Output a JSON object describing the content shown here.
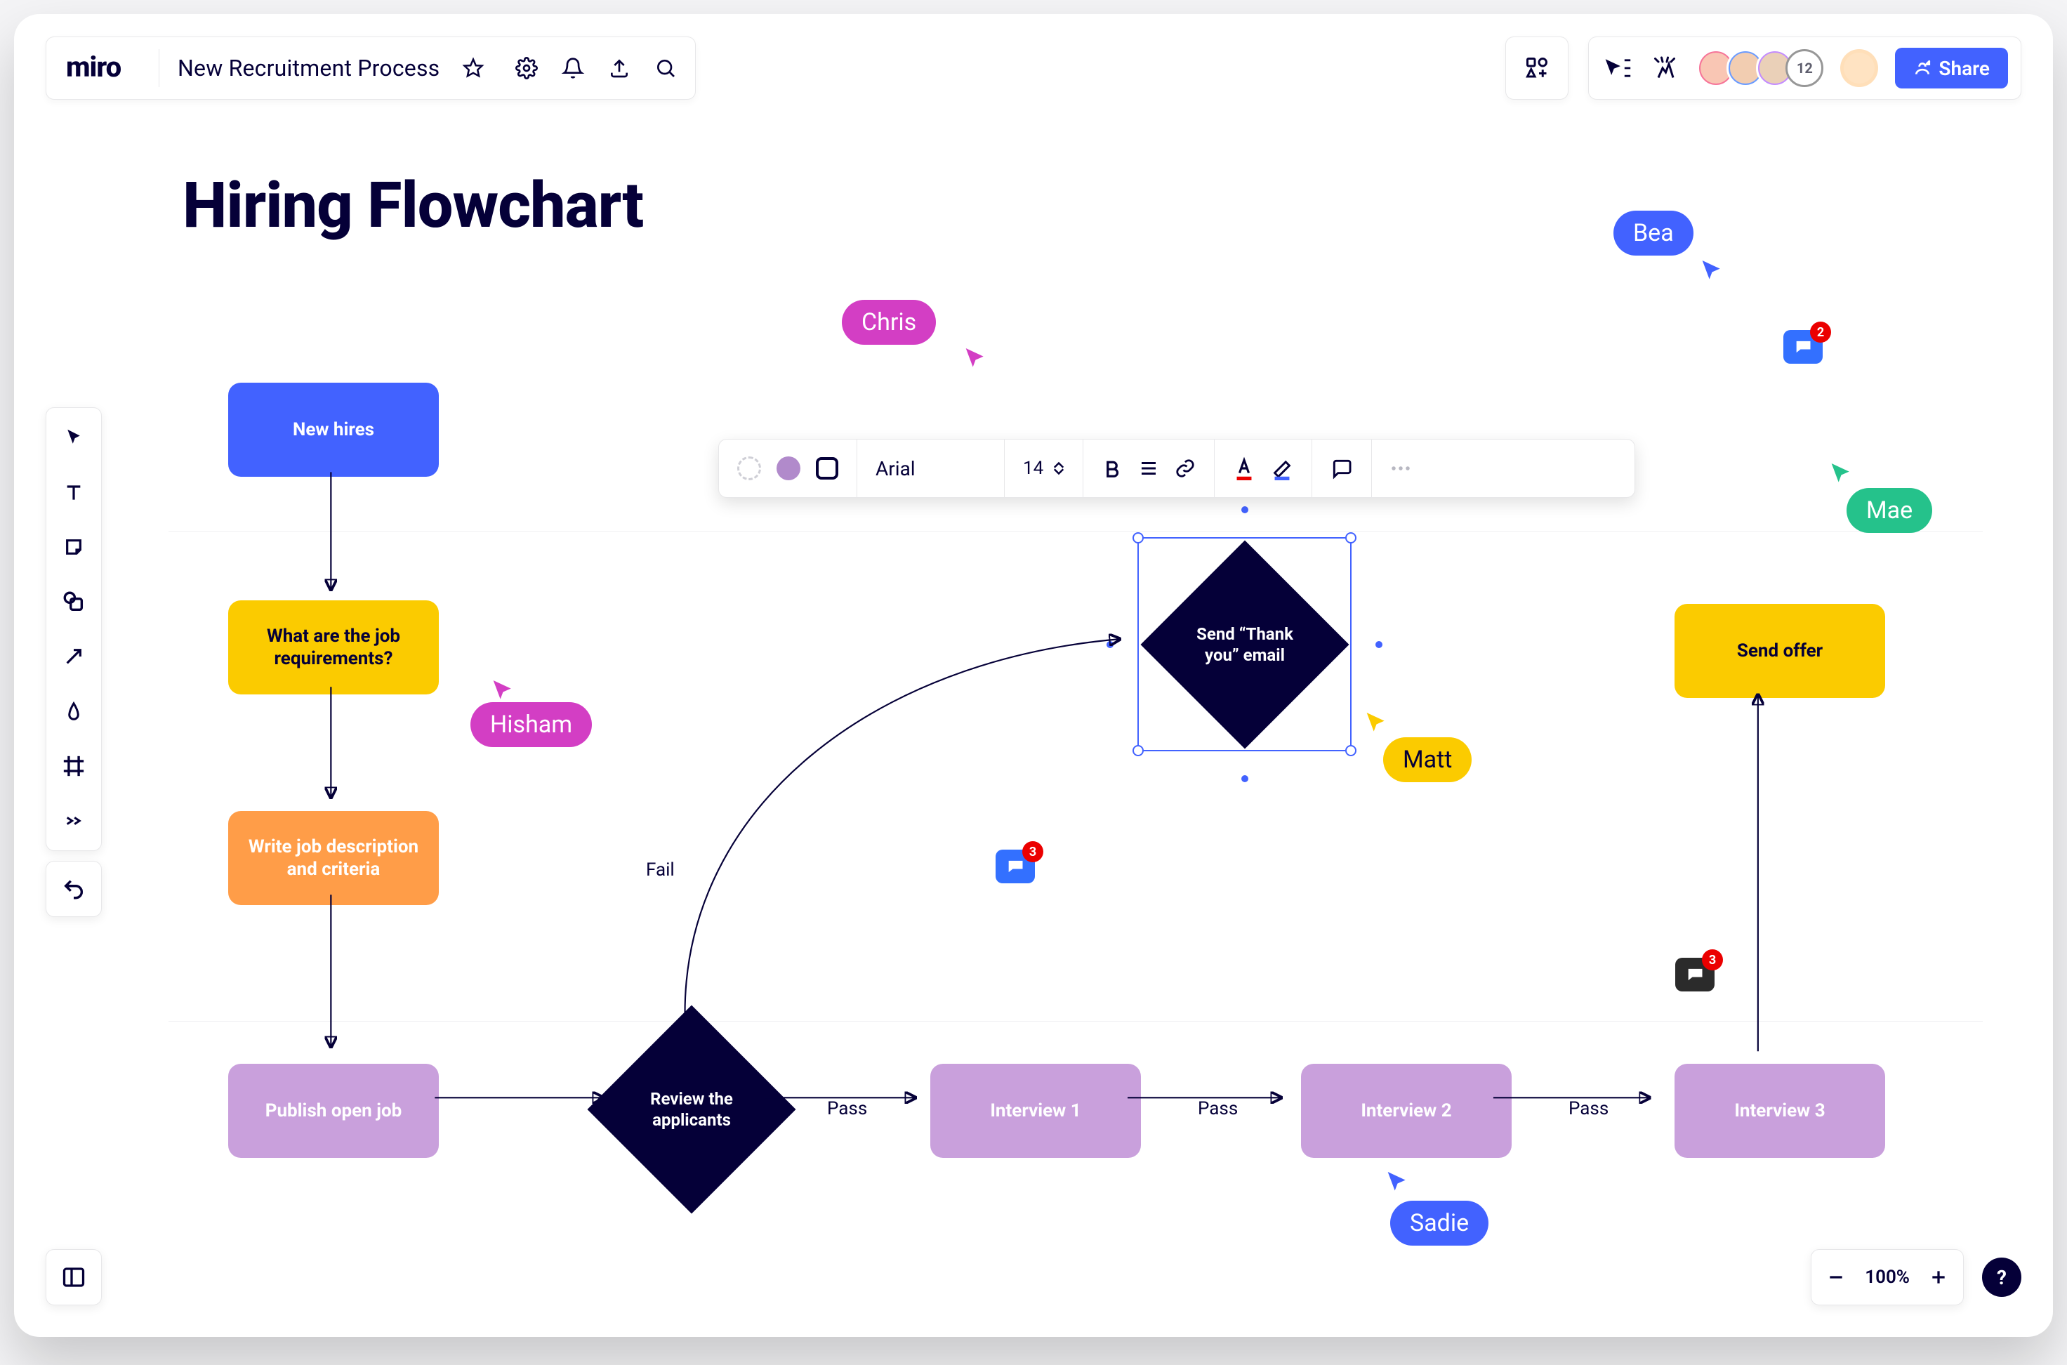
{
  "app": {
    "logo_text": "miro",
    "board_title": "New Recruitment Process",
    "share_label": "Share",
    "avatar_overflow": "12",
    "zoom_label": "100%"
  },
  "canvas": {
    "title": "Hiring Flowchart",
    "nodes": {
      "new_hires": "New hires",
      "requirements": "What are the job requirements?",
      "write_desc": "Write job description and criteria",
      "publish": "Publish open job",
      "review": "Review the applicants",
      "thank_you": "Send “Thank you” email",
      "interview1": "Interview 1",
      "interview2": "Interview 2",
      "interview3": "Interview 3",
      "send_offer": "Send offer"
    },
    "edges": {
      "fail": "Fail",
      "pass1": "Pass",
      "pass2": "Pass",
      "pass3": "Pass"
    }
  },
  "ctx": {
    "font_name": "Arial",
    "font_size": "14"
  },
  "cursors": {
    "chris": "Chris",
    "hisham": "Hisham",
    "matt": "Matt",
    "bea": "Bea",
    "mae": "Mae",
    "sadie": "Sadie"
  },
  "comments": {
    "c1": "3",
    "c2": "3",
    "c3": "2"
  },
  "colors": {
    "chris": "#D33EC4",
    "hisham": "#D33EC4",
    "matt": "#FBCB00",
    "bea": "#4262FF",
    "mae": "#25C28B",
    "sadie": "#4262FF"
  }
}
